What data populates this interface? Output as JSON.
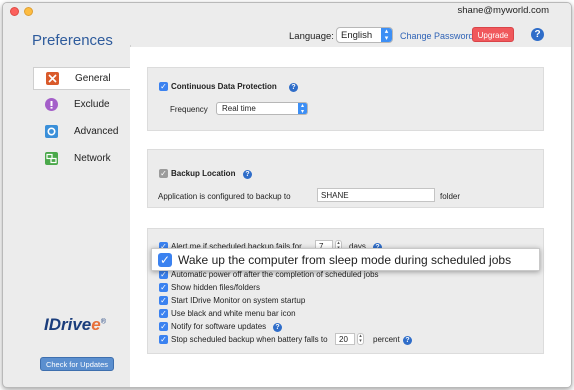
{
  "window": {
    "account": "shane@myworld.com"
  },
  "header": {
    "title": "Preferences",
    "language_label": "Language:",
    "language_value": "English",
    "change_password": "Change Password",
    "upgrade": "Upgrade",
    "help": "?"
  },
  "sidebar": {
    "items": [
      {
        "label": "General",
        "icon": "tools-icon",
        "active": true
      },
      {
        "label": "Exclude",
        "icon": "exclude-icon",
        "active": false
      },
      {
        "label": "Advanced",
        "icon": "gear-icon",
        "active": false
      },
      {
        "label": "Network",
        "icon": "network-icon",
        "active": false
      }
    ],
    "logo": "IDrive",
    "logo_e": "e",
    "logo_mark": "®",
    "check_updates": "Check for Updates"
  },
  "cdp": {
    "label": "Continuous Data Protection",
    "frequency_label": "Frequency",
    "frequency_value": "Real time"
  },
  "backup_location": {
    "label": "Backup Location",
    "configured_text": "Application is configured to backup to",
    "value": "SHANE",
    "suffix": "folder"
  },
  "options": {
    "alert_label": "Alert me if scheduled backup fails for",
    "alert_days_value": "7",
    "alert_days_unit": "days",
    "wake_label": "Wake up the computer from sleep mode during scheduled jobs",
    "auto_power_off": "Automatic power off after the completion of scheduled jobs",
    "show_hidden": "Show hidden files/folders",
    "start_monitor": "Start IDrive Monitor on system startup",
    "bw_menu_icon": "Use black and white menu bar icon",
    "notify_updates": "Notify for software updates",
    "stop_battery": "Stop scheduled backup when battery falls to",
    "battery_value": "20",
    "battery_unit": "percent"
  },
  "colors": {
    "accent": "#3b82f0",
    "upgrade": "#f0585c",
    "title": "#2e5b9c"
  }
}
